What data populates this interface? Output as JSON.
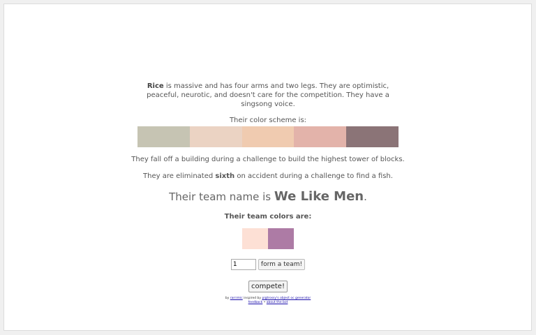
{
  "character": {
    "name": "Rice",
    "description": "is massive and has four arms and two legs. They are optimistic, peaceful, neurotic, and doesn't care for the competition. They have a singsong voice."
  },
  "color_scheme": {
    "label": "Their color scheme is:",
    "colors": [
      "#c6c4b3",
      "#ebd3c3",
      "#f0cbb0",
      "#e3b3aa",
      "#8b7477"
    ]
  },
  "fate": "They fall off a building during a challenge to build the highest tower of blocks.",
  "elimination": {
    "prefix": "They are eliminated",
    "place": "sixth",
    "suffix": "on accident during a challenge to find a fish."
  },
  "team": {
    "name_prefix": "Their team name is",
    "name": "We Like Men",
    "name_suffix": ".",
    "colors_label": "Their team colors are:",
    "colors": [
      "#fde0d5",
      "#ad7ba5"
    ]
  },
  "form": {
    "team_count_value": "1",
    "form_team_label": "form a team!",
    "compete_label": "compete!"
  },
  "footer": {
    "by": "by",
    "author": "rarrrmic",
    "inspired": "inspired by",
    "inspiration": "pigtrossy's object oc generator",
    "feedback": "feedback",
    "separator": "•",
    "about": "about the bot"
  }
}
